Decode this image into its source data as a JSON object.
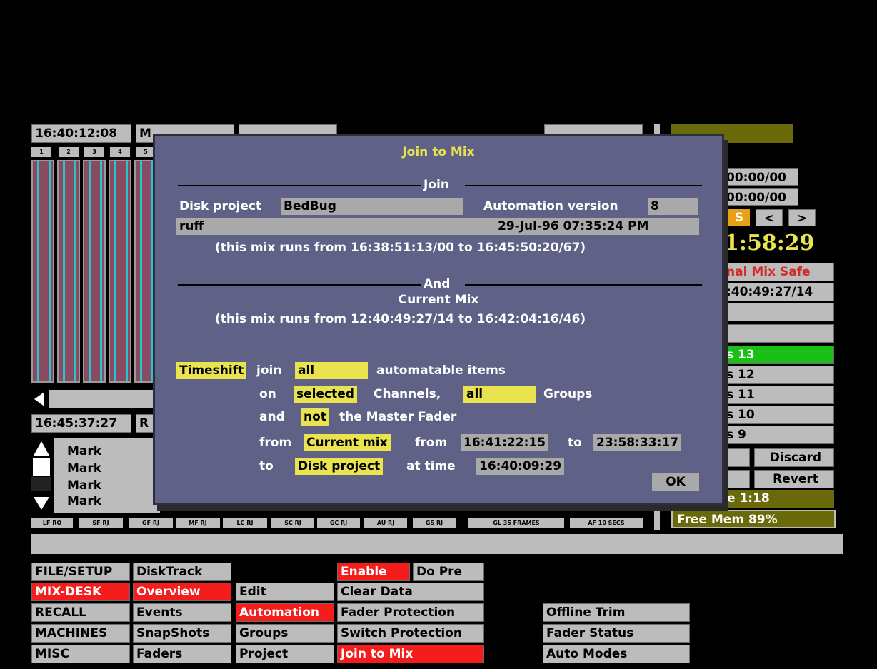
{
  "topbar": {
    "tc": "16:40:12:08",
    "b1": "M",
    "b2": "",
    "b3": "",
    "b4": "",
    "b5": ""
  },
  "channel_buttons": [
    "1",
    "2",
    "3",
    "4",
    "5"
  ],
  "timeline": {
    "tc2": "16:45:37:27",
    "r": "R"
  },
  "marks": [
    "Mark",
    "Mark",
    "Mark",
    "Mark"
  ],
  "status_buttons": [
    "LF RO",
    "SF RJ",
    "GF RJ",
    "MF RJ",
    "LC RJ",
    "SC RJ",
    "GC RJ",
    "AU RJ",
    "GS RJ",
    "GL 35 FRAMES",
    "AF 10 SECS"
  ],
  "right": {
    "tc_a": "00:00/00",
    "tc_b": "00:00/00",
    "s": "S",
    "prev": "<",
    "next": ">",
    "clock": "1:58:29",
    "final_safe": "nal Mix Safe",
    "tc_c": ":40:49:27/14",
    "pass_items": [
      "s 13",
      "s 12",
      "s 11",
      "s 10",
      "s 9"
    ],
    "discard": "Discard",
    "revert": "Revert",
    "free_time": "e  1:18",
    "free_mem": "Free  Mem  89%"
  },
  "dialog": {
    "title": "Join  to  Mix",
    "join_heading": "Join",
    "disk_project_label": "Disk  project",
    "disk_project_value": "BedBug",
    "automation_label": "Automation  version",
    "automation_value": "8",
    "mix_name": "ruff",
    "mix_date": "29-Jul-96  07:35:24  PM",
    "mix1_range": "(this  mix  runs  from  16:38:51:13/00  to  16:45:50:20/67)",
    "and_heading": "And",
    "current_mix": "Current  Mix",
    "mix2_range": "(this  mix  runs  from  12:40:49:27/14  to  16:42:04:16/46)",
    "timeshift": "Timeshift",
    "join_word": "join",
    "all1": "all",
    "automatable": "automatable  items",
    "on_word": "on",
    "selected": "selected",
    "channels_word": "Channels,",
    "all2": "all",
    "groups_word": "Groups",
    "and_word": "and",
    "not_word": "not",
    "master_fader": "the  Master  Fader",
    "from_word": "from",
    "current_mix_sel": "Current  mix",
    "from_word2": "from",
    "from_tc": "16:41:22:15",
    "to_word": "to",
    "to_tc": "23:58:33:17",
    "to_word2": "to",
    "disk_project_sel": "Disk  project",
    "at_time": "at  time",
    "at_tc": "16:40:09:29",
    "ok": "OK"
  },
  "menu": {
    "col1": [
      "FILE/SETUP",
      "MIX-DESK",
      "RECALL",
      "MACHINES",
      "MISC"
    ],
    "col2": [
      "DiskTrack",
      "Overview",
      "Events",
      "SnapShots",
      "Faders"
    ],
    "col3": [
      "Edit",
      "Automation",
      "Groups",
      "Project"
    ],
    "col4": [
      "Enable",
      "Do  Pre",
      "Clear  Data",
      "Fader  Protection",
      "Switch  Protection",
      "Join  to  Mix"
    ],
    "col5": [
      "Offline  Trim",
      "Fader  Status",
      "Auto  Modes"
    ]
  }
}
